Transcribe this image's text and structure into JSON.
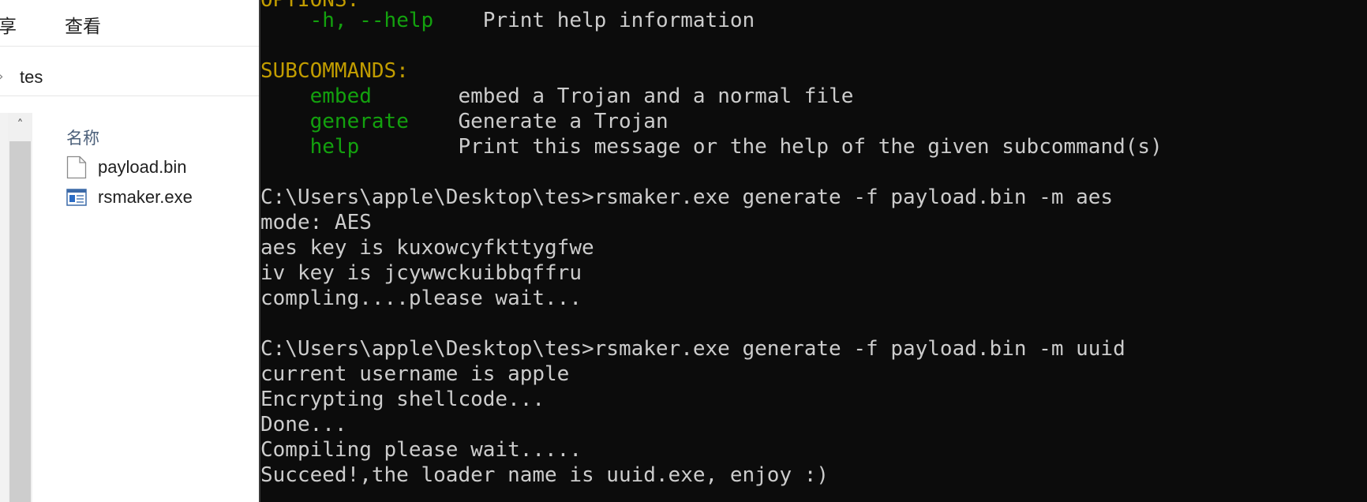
{
  "explorer": {
    "ribbon_tabs": [
      "享",
      "查看"
    ],
    "address": "tes",
    "column_header": "名称",
    "files": [
      {
        "name": "payload.bin",
        "icon": "document-icon"
      },
      {
        "name": "rsmaker.exe",
        "icon": "application-icon"
      }
    ]
  },
  "console": {
    "options_fragment": "OPTIONS:",
    "help_flag": "-h, --help",
    "help_desc": "Print help information",
    "subcommands_header": "SUBCOMMANDS:",
    "subcommands": [
      {
        "name": "embed",
        "desc": "embed a Trojan and a normal file"
      },
      {
        "name": "generate",
        "desc": "Generate a Trojan"
      },
      {
        "name": "help",
        "desc": "Print this message or the help of the given subcommand(s)"
      }
    ],
    "output_lines": [
      "C:\\Users\\apple\\Desktop\\tes>rsmaker.exe generate -f payload.bin -m aes",
      "mode: AES",
      "aes key is kuxowcyfkttygfwe",
      "iv key is jcywwckuibbqffru",
      "compling....please wait...",
      "",
      "C:\\Users\\apple\\Desktop\\tes>rsmaker.exe generate -f payload.bin -m uuid",
      "current username is apple",
      "Encrypting shellcode...",
      "Done...",
      "Compiling please wait.....",
      "Succeed!,the loader name is uuid.exe, enjoy :)"
    ],
    "colors": {
      "background": "#0c0c0c",
      "text": "#cccccc",
      "header": "#c19c00",
      "keyword": "#13a10e"
    }
  }
}
